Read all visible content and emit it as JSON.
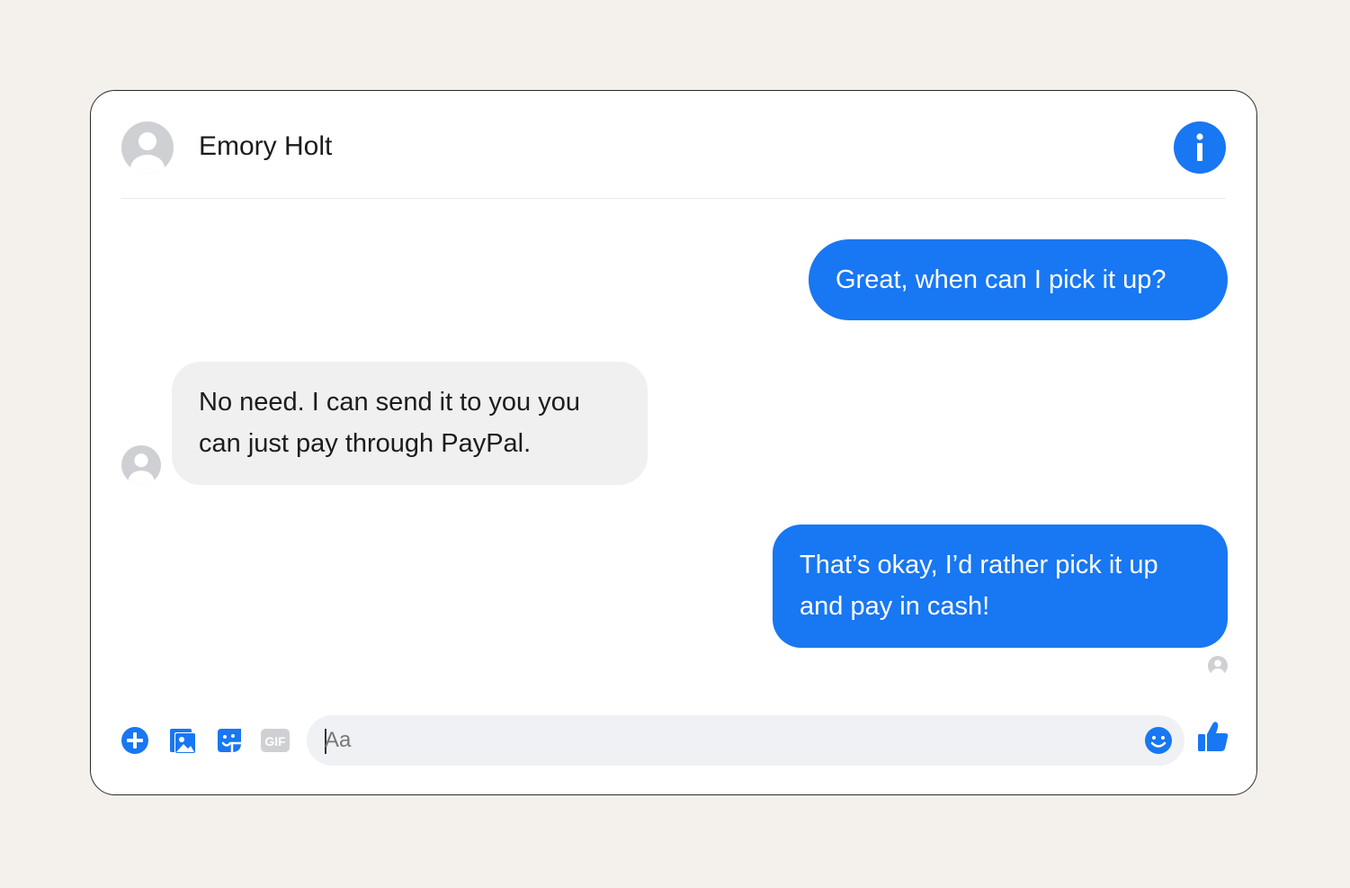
{
  "contact": {
    "name": "Emory Holt",
    "avatar_icon": "person-silhouette-icon"
  },
  "header": {
    "info_icon": "info-icon"
  },
  "messages": [
    {
      "direction": "outgoing",
      "lines": [
        "Great, when can I pick it up?"
      ]
    },
    {
      "direction": "incoming",
      "lines": [
        "No need. I can send it to you you",
        "can just pay through PayPal."
      ]
    },
    {
      "direction": "outgoing",
      "lines": [
        "That’s okay, I’d rather pick it up",
        "and pay in cash!"
      ]
    }
  ],
  "composer": {
    "placeholder": "Aa",
    "actions": [
      {
        "name": "add",
        "icon": "plus-circle-icon"
      },
      {
        "name": "photo",
        "icon": "photo-icon"
      },
      {
        "name": "sticker",
        "icon": "sticker-icon"
      },
      {
        "name": "gif",
        "icon": "gif-icon",
        "label": "GIF"
      }
    ],
    "emoji_icon": "smiley-icon",
    "like_icon": "thumbs-up-icon"
  },
  "colors": {
    "accent": "#1877f2",
    "incoming_bubble": "#f0f0f0",
    "background": "#f4f1ec",
    "avatar_gray": "#cfd0d3"
  }
}
